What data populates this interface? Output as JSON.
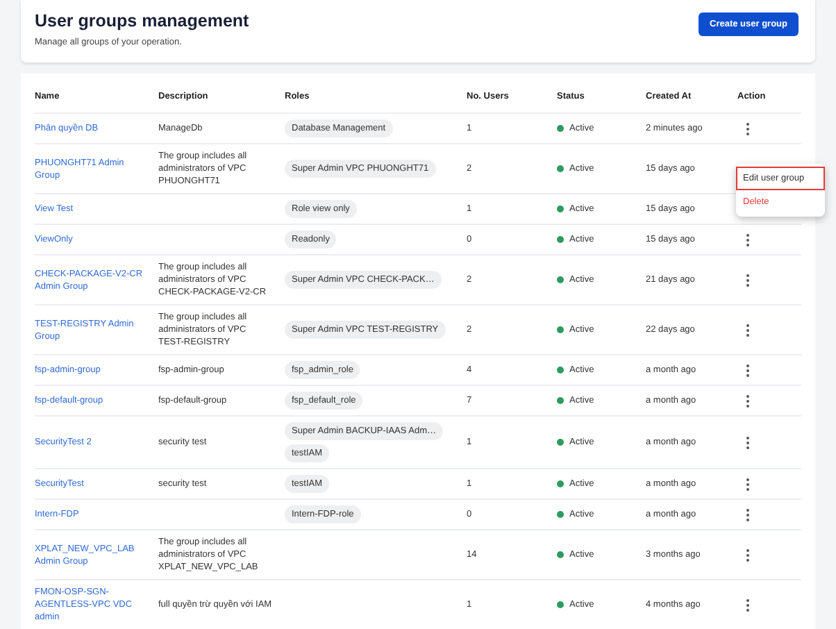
{
  "header": {
    "title": "User groups management",
    "subtitle": "Manage all groups of your operation.",
    "create_button": "Create user group"
  },
  "table": {
    "columns": [
      "Name",
      "Description",
      "Roles",
      "No. Users",
      "Status",
      "Created At",
      "Action"
    ],
    "rows": [
      {
        "name": "Phân quyền DB",
        "description": "ManageDb",
        "roles": [
          "Database Management"
        ],
        "users": "1",
        "status": "Active",
        "created_at": "2 minutes ago",
        "menu_open": false
      },
      {
        "name": "PHUONGHT71 Admin Group",
        "description": "The group includes all administrators of VPC PHUONGHT71",
        "roles": [
          "Super Admin VPC PHUONGHT71"
        ],
        "users": "2",
        "status": "Active",
        "created_at": "15 days ago",
        "menu_open": true
      },
      {
        "name": "View Test",
        "roles": [
          "Role view only"
        ],
        "users": "1",
        "status": "Active",
        "created_at": "15 days ago",
        "menu_open": false
      },
      {
        "name": "ViewOnly",
        "roles": [
          "Readonly"
        ],
        "users": "0",
        "status": "Active",
        "created_at": "15 days ago",
        "menu_open": false
      },
      {
        "name": "CHECK-PACKAGE-V2-CR Admin Group",
        "description": "The group includes all administrators of VPC CHECK-PACKAGE-V2-CR",
        "roles": [
          "Super Admin VPC CHECK-PACK…"
        ],
        "users": "2",
        "status": "Active",
        "created_at": "21 days ago",
        "menu_open": false
      },
      {
        "name": "TEST-REGISTRY Admin Group",
        "description": "The group includes all administrators of VPC TEST-REGISTRY",
        "roles": [
          "Super Admin VPC TEST-REGISTRY"
        ],
        "users": "2",
        "status": "Active",
        "created_at": "22 days ago",
        "menu_open": false
      },
      {
        "name": "fsp-admin-group",
        "description": "fsp-admin-group",
        "roles": [
          "fsp_admin_role"
        ],
        "users": "4",
        "status": "Active",
        "created_at": "a month ago",
        "menu_open": false
      },
      {
        "name": "fsp-default-group",
        "description": "fsp-default-group",
        "roles": [
          "fsp_default_role"
        ],
        "users": "7",
        "status": "Active",
        "created_at": "a month ago",
        "menu_open": false
      },
      {
        "name": "SecurityTest 2",
        "description": "security test",
        "roles": [
          "Super Admin BACKUP-IAAS Adm…",
          "testIAM"
        ],
        "users": "1",
        "status": "Active",
        "created_at": "a month ago",
        "menu_open": false
      },
      {
        "name": "SecurityTest",
        "description": "security test",
        "roles": [
          "testIAM"
        ],
        "users": "1",
        "status": "Active",
        "created_at": "a month ago",
        "menu_open": false
      },
      {
        "name": "Intern-FDP",
        "roles": [
          "Intern-FDP-role"
        ],
        "users": "0",
        "status": "Active",
        "created_at": "a month ago",
        "menu_open": false
      },
      {
        "name": "XPLAT_NEW_VPC_LAB Admin Group",
        "description": "The group includes all administrators of VPC XPLAT_NEW_VPC_LAB",
        "users": "14",
        "status": "Active",
        "created_at": "3 months ago",
        "menu_open": false
      },
      {
        "name": "FMON-OSP-SGN-AGENTLESS-VPC VDC admin",
        "description": "full quyền trừ quyền với IAM",
        "users": "1",
        "status": "Active",
        "created_at": "4 months ago",
        "menu_open": false
      }
    ]
  },
  "action_menu": {
    "items": [
      {
        "label": "Edit user group",
        "kind": "normal",
        "selected": true
      },
      {
        "label": "Delete",
        "kind": "danger",
        "selected": false
      }
    ]
  }
}
